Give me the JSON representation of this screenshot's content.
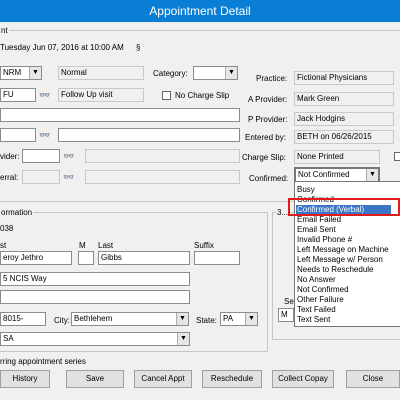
{
  "window": {
    "title": "Appointment Detail"
  },
  "appointment": {
    "date_line": "Tuesday Jun 07, 2016 at 10:00 AM",
    "section_glyph": "§",
    "header_label": "nt"
  },
  "left": {
    "type_code": "NRM",
    "type_desc": "Normal",
    "category_label": "Category:",
    "category_value": "",
    "visit_code": "FU",
    "visit_desc": "Follow Up visit",
    "no_charge_label": "No Charge Slip",
    "rovider_label": "vider:",
    "referral_label": "erral:"
  },
  "right": {
    "practice_label": "Practice:",
    "practice_value": "Fictional Physicians",
    "a_provider_label": "A Provider:",
    "a_provider_value": "Mark  Green",
    "p_provider_label": "P Provider:",
    "p_provider_value": "Jack Hodgins",
    "entered_label": "Entered by:",
    "entered_value": "BETH on 06/26/2015",
    "charge_label": "Charge Slip:",
    "charge_value": "None Printed",
    "confirmed_label": "Confirmed:",
    "confirmed_value": "Not Confirmed"
  },
  "patient": {
    "group_label": "ormation",
    "id_fragment": "038",
    "first_label": "st",
    "m_label": "M",
    "last_label": "Last",
    "suffix_label": "Suffix",
    "first_value": "eroy Jethro",
    "last_value": "Gibbs",
    "address": "5 NCIS Way",
    "zip": "8015-",
    "city_label": "City:",
    "city_value": "Bethlehem",
    "state_label": "State:",
    "state_value": "PA",
    "country": "SA",
    "other_label": "3...",
    "se_label": "Se",
    "m_box": "M"
  },
  "confirmation_options": [
    "Busy",
    "Confirmed",
    "Confirmed (Verbal)",
    "Email Failed",
    "Email Sent",
    "Invalid Phone #",
    "Left Message on Machine",
    "Left Message w/ Person",
    "Needs to Reschedule",
    "No Answer",
    "Not Confirmed",
    "Other Failure",
    "Text Failed",
    "Text Sent"
  ],
  "selected_option_index": 2,
  "recurring_label": "rring appointment series",
  "buttons": {
    "history": "History",
    "save": "Save",
    "cancel_appt": "Cancel Appt",
    "reschedule": "Reschedule",
    "collect_copay": "Collect Copay",
    "close": "Close"
  },
  "colors": {
    "titlebar": "#0a7ed4",
    "selection": "#3c76c4",
    "highlight_box": "#e21b1b"
  },
  "icons": {
    "binoculars": "binoculars-icon",
    "dropdown": "chevron-down-icon"
  }
}
